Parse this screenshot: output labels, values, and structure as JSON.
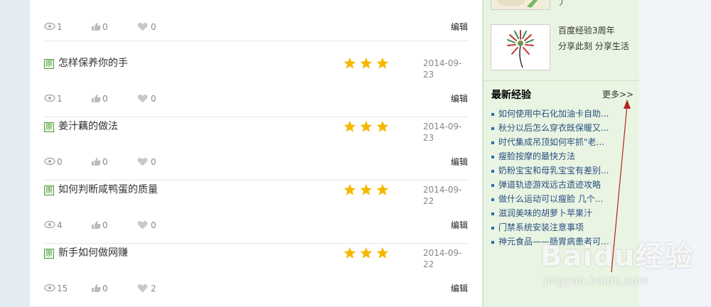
{
  "articles": [
    {
      "badge": "原",
      "title": "怎样保养你的手",
      "date": "2014-09-23",
      "views": "1",
      "likes": "0",
      "favs": "0",
      "edit": "编辑"
    },
    {
      "badge": "原",
      "title": "姜汁藕的做法",
      "date": "2014-09-23",
      "views": "0",
      "likes": "0",
      "favs": "0",
      "edit": "编辑"
    },
    {
      "badge": "原",
      "title": "如何判断咸鸭蛋的质量",
      "date": "2014-09-22",
      "views": "4",
      "likes": "0",
      "favs": "0",
      "edit": "编辑"
    },
    {
      "badge": "原",
      "title": "新手如何做网赚",
      "date": "2014-09-22",
      "views": "15",
      "likes": "0",
      "favs": "2",
      "edit": "编辑"
    }
  ],
  "first_stats": {
    "views": "1",
    "likes": "0",
    "favs": "0",
    "edit": "编辑"
  },
  "sidebar": {
    "promo_line1": "百度经验3周年",
    "promo_line2": "分享此刻 分享生活",
    "latest_heading": "最新经验",
    "more_label": "更多>>",
    "latest_items": [
      "如何使用中石化加油卡自助...",
      "秋分以后怎么穿衣既保暖又...",
      "时代集成吊顶如何牢抓\"老...",
      "瘦脸按摩的最快方法",
      "奶粉宝宝和母乳宝宝有差别...",
      "弹道轨迹游戏远古遗迹攻略",
      "做什么运动可以瘦脸 几个...",
      "滋润美味的胡萝卜苹果汁",
      "门禁系统安装注意事项",
      "神元食品——肠胃病患者可..."
    ]
  },
  "watermark": {
    "logo": "Baidu经验",
    "url": "jingyan.baidu.com"
  },
  "colors": {
    "star": "#f5b800",
    "link": "#2b4f82",
    "badge": "#4e9a3a",
    "sidebar_bg": "#e9f5e2",
    "annotation": "#b22222"
  }
}
